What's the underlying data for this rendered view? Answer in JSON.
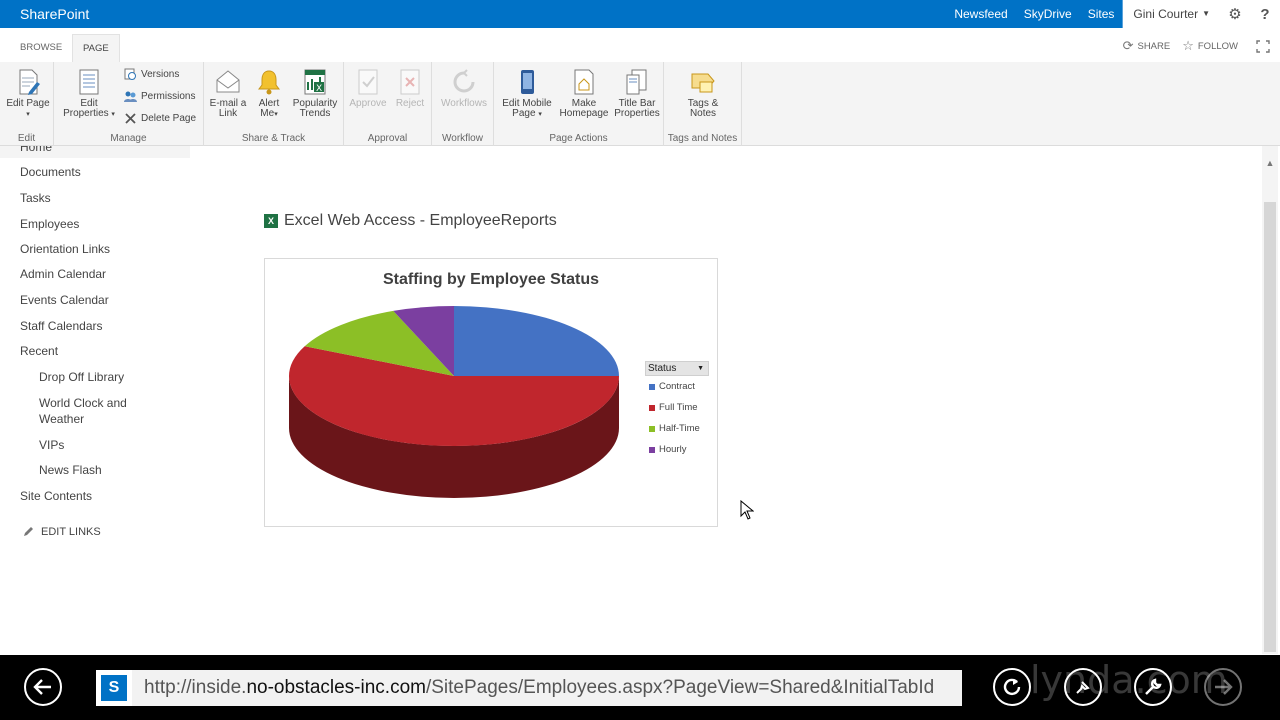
{
  "suitebar": {
    "brand": "SharePoint",
    "links": [
      "Newsfeed",
      "SkyDrive",
      "Sites"
    ],
    "active_link": "Sites",
    "user": "Gini Courter",
    "icons": [
      "gear-icon",
      "help-icon"
    ]
  },
  "ribbon_tabs": {
    "browse": "BROWSE",
    "page": "PAGE",
    "share": "SHARE",
    "follow": "FOLLOW"
  },
  "ribbon": {
    "edit": {
      "label": "Edit",
      "edit_page": "Edit Page"
    },
    "manage": {
      "label": "Manage",
      "edit_properties_1": "Edit",
      "edit_properties_2": "Properties",
      "versions": "Versions",
      "permissions": "Permissions",
      "delete_page": "Delete Page"
    },
    "share_track": {
      "label": "Share & Track",
      "email_1": "E-mail a",
      "email_2": "Link",
      "alert_1": "Alert",
      "alert_2": "Me",
      "popularity_1": "Popularity",
      "popularity_2": "Trends"
    },
    "approval": {
      "label": "Approval",
      "approve": "Approve",
      "reject": "Reject"
    },
    "workflow": {
      "label": "Workflow",
      "workflows": "Workflows"
    },
    "page_actions": {
      "label": "Page Actions",
      "mobile_1": "Edit Mobile",
      "mobile_2": "Page",
      "homepage_1": "Make",
      "homepage_2": "Homepage",
      "titlebar_1": "Title Bar",
      "titlebar_2": "Properties"
    },
    "tags_notes": {
      "label": "Tags and Notes",
      "tags_1": "Tags &",
      "tags_2": "Notes"
    }
  },
  "leftnav": {
    "home": "Home",
    "items": [
      "Documents",
      "Tasks",
      "Employees",
      "Orientation Links",
      "Admin Calendar",
      "Events Calendar",
      "Staff Calendars",
      "Recent"
    ],
    "recent_items": [
      "Drop Off Library",
      "World Clock and",
      "Weather",
      "VIPs",
      "News Flash"
    ],
    "site_contents": "Site Contents",
    "edit_links": "EDIT LINKS"
  },
  "webpart": {
    "title": "Excel Web Access - EmployeeReports",
    "excel_glyph": "X"
  },
  "chart_data": {
    "type": "pie",
    "title": "Staffing by Employee Status",
    "legend_title": "Status",
    "legend_position": "right",
    "categories": [
      "Contract",
      "Full Time",
      "Half-Time",
      "Hourly"
    ],
    "values": [
      25,
      57,
      12,
      6
    ],
    "colors": [
      "#4472c4",
      "#c0262d",
      "#8cbf26",
      "#7b3fa0"
    ]
  },
  "browser": {
    "url_prefix": "http://inside.",
    "url_domain": "no-obstacles-inc.com",
    "url_path": "/SitePages/Employees.aspx?PageView=Shared&InitialTabId",
    "favicon": "S"
  },
  "watermark": "lynda.com"
}
